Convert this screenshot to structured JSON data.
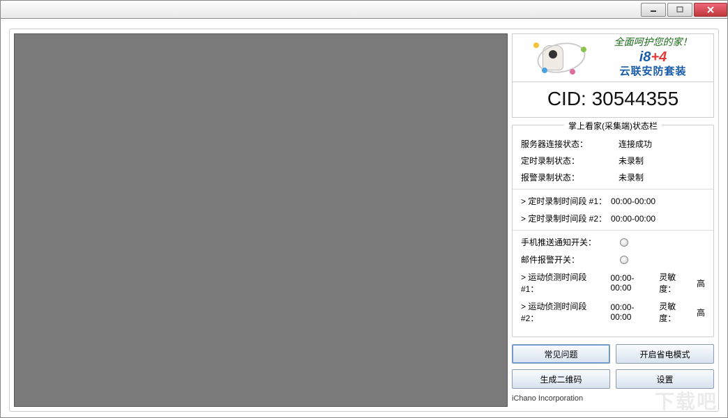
{
  "promo": {
    "line1": "全面呵护您的家！",
    "line2_main": "i8",
    "line2_plus": "+4",
    "line3": "云联安防套装"
  },
  "cid": {
    "prefix": "CID: ",
    "value": "30544355"
  },
  "status": {
    "group_title": "掌上看家(采集端)状态栏",
    "server_label": "服务器连接状态：",
    "server_value": "连接成功",
    "timer_rec_label": "定时录制状态：",
    "timer_rec_value": "未录制",
    "alarm_rec_label": "报警录制状态：",
    "alarm_rec_value": "未录制",
    "sched1_label": "> 定时录制时间段 #1：",
    "sched1_value": "00:00-00:00",
    "sched2_label": "> 定时录制时间段 #2：",
    "sched2_value": "00:00-00:00",
    "push_label": "手机推送通知开关：",
    "mail_label": "邮件报警开关：",
    "motion1_label": "> 运动侦测时间段 #1：",
    "motion1_value": "00:00-00:00",
    "motion1_sens_label": "灵敏度：",
    "motion1_sens_value": "高",
    "motion2_label": "> 运动侦测时间段 #2：",
    "motion2_value": "00:00-00:00",
    "motion2_sens_label": "灵敏度：",
    "motion2_sens_value": "高"
  },
  "buttons": {
    "faq": "常见问题",
    "power_save": "开启省电模式",
    "qrcode": "生成二维码",
    "settings": "设置"
  },
  "footer": {
    "company": "iChano Incorporation"
  },
  "watermark": "下载吧"
}
